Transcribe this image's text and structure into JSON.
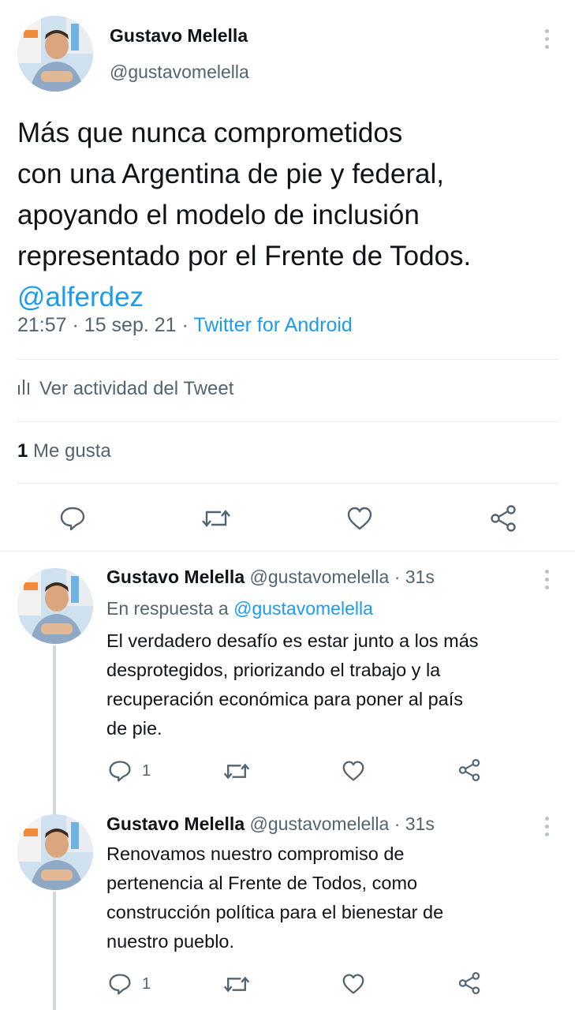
{
  "main_tweet": {
    "author_name": "Gustavo Melella",
    "author_handle": "@gustavomelella",
    "text_lines": [
      "Más que nunca comprometidos",
      "con una Argentina de pie y federal,",
      "apoyando el modelo de inclusión",
      "representado por el Frente de Todos."
    ],
    "mention": "@alferdez",
    "time": "21:57",
    "date": "15 sep. 21",
    "source": "Twitter for Android",
    "activity_label": "Ver actividad del Tweet",
    "likes_count": "1",
    "likes_label": "Me gusta"
  },
  "replies": [
    {
      "author_name": "Gustavo Melella",
      "author_handle": "@gustavomelella",
      "time_ago": "31s",
      "in_reply_prefix": "En respuesta a",
      "in_reply_handle": "@gustavomelella",
      "text_lines": [
        "El verdadero desafío es estar junto a los más",
        "desprotegidos, priorizando el trabajo y la",
        "recuperación económica para poner al país",
        "de pie."
      ],
      "reply_count": "1"
    },
    {
      "author_name": "Gustavo Melella",
      "author_handle": "@gustavomelella",
      "time_ago": "31s",
      "text_lines": [
        "Renovamos nuestro compromiso de",
        "pertenencia al Frente de Todos, como",
        "construcción política para el bienestar de",
        "nuestro pueblo."
      ],
      "reply_count": "1"
    }
  ],
  "icons": {
    "reply": "comment-bubble-icon",
    "retweet": "retweet-icon",
    "like": "heart-icon",
    "share": "share-icon",
    "more": "more-vertical-icon",
    "analytics": "bar-chart-icon"
  },
  "colors": {
    "link": "#1d9bf0",
    "secondary_text": "#536471",
    "primary_text": "#0f1419",
    "divider": "#e6ecf0"
  }
}
